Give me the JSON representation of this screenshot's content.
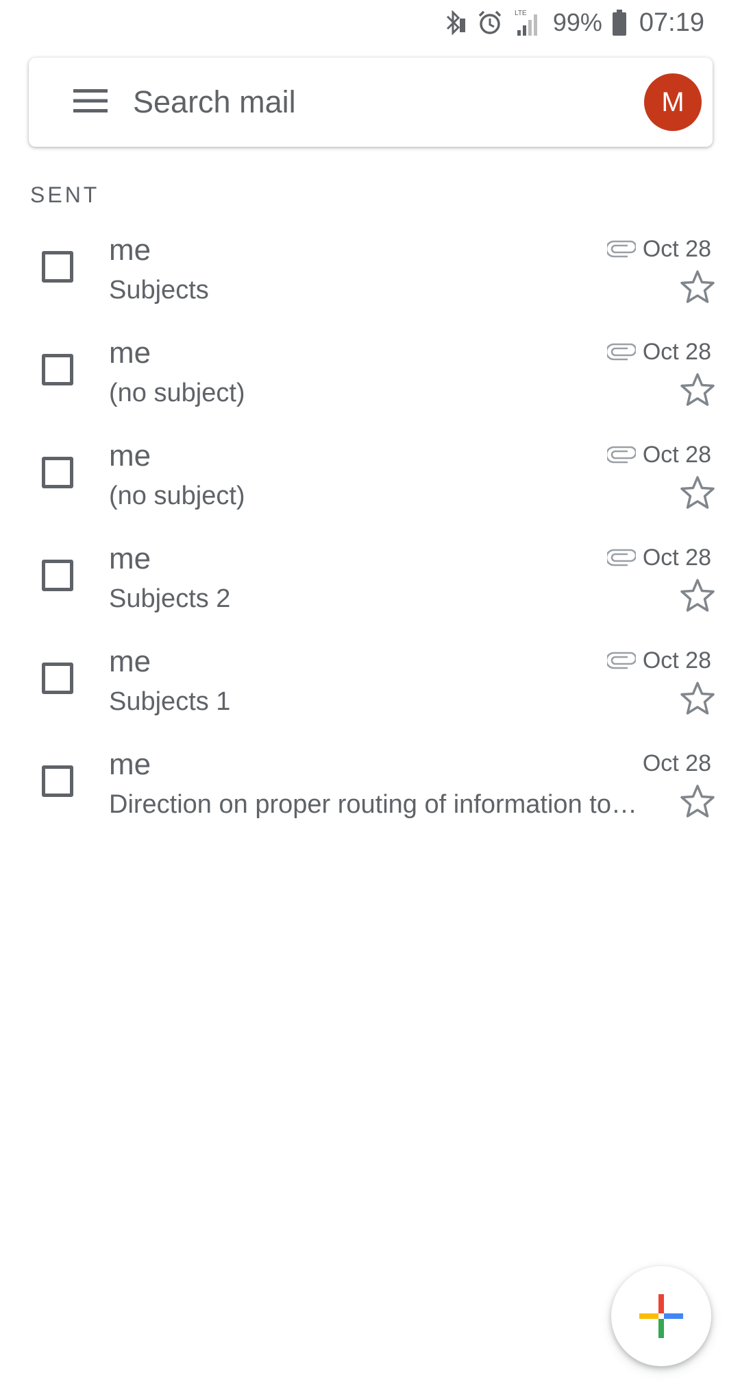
{
  "status_bar": {
    "icons": [
      "bluetooth-icon",
      "alarm-icon",
      "lte-signal-icon",
      "battery-icon"
    ],
    "lte_label": "LTE",
    "battery_percent": "99%",
    "time": "07:19"
  },
  "search": {
    "placeholder": "Search mail",
    "avatar_letter": "M",
    "avatar_color": "#c5391a"
  },
  "section": {
    "label": "SENT"
  },
  "emails": [
    {
      "sender": "me",
      "subject": "Subjects",
      "date": "Oct 28",
      "has_attachment": true,
      "starred": false
    },
    {
      "sender": "me",
      "subject": "(no subject)",
      "date": "Oct 28",
      "has_attachment": true,
      "starred": false
    },
    {
      "sender": "me",
      "subject": "(no subject)",
      "date": "Oct 28",
      "has_attachment": true,
      "starred": false
    },
    {
      "sender": "me",
      "subject": "Subjects 2",
      "date": "Oct 28",
      "has_attachment": true,
      "starred": false
    },
    {
      "sender": "me",
      "subject": "Subjects 1",
      "date": "Oct 28",
      "has_attachment": true,
      "starred": false
    },
    {
      "sender": "me",
      "subject": "Direction on proper routing of information to…",
      "date": "Oct 28",
      "has_attachment": false,
      "starred": false
    }
  ],
  "fab": {
    "icon": "compose-plus-icon",
    "colors": {
      "top": "#ea4335",
      "right": "#4285f4",
      "bottom": "#34a853",
      "left": "#fbbc04"
    }
  }
}
